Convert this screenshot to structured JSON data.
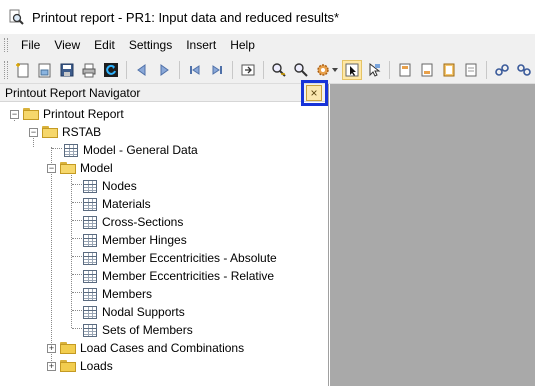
{
  "window": {
    "title": "Printout report - PR1: Input data and reduced results*",
    "icon": "report-magnifier-icon"
  },
  "menubar": {
    "items": [
      "File",
      "View",
      "Edit",
      "Settings",
      "Insert",
      "Help"
    ]
  },
  "toolbar": {
    "buttons": [
      "new-report-icon",
      "open-icon",
      "save-icon",
      "print-icon",
      "refresh-icon",
      "previous-icon",
      "next-icon",
      "first-page-icon",
      "last-page-icon",
      "export-icon",
      "zoom-in-icon",
      "zoom-out-icon",
      "settings-icon",
      "navigator-toggle-icon",
      "select-cursor-icon",
      "page-header-icon",
      "page-icon-1",
      "page-icon-2",
      "page-icon-3",
      "link-icon-1",
      "link-icon-2"
    ],
    "active_button": "navigator-toggle-icon"
  },
  "navigator": {
    "header": "Printout Report Navigator",
    "close_symbol": "×",
    "tree": {
      "root": "Printout Report",
      "rstab": "RSTAB",
      "general": "Model - General Data",
      "model": "Model",
      "model_items": [
        "Nodes",
        "Materials",
        "Cross-Sections",
        "Member Hinges",
        "Member Eccentricities - Absolute",
        "Member Eccentricities - Relative",
        "Members",
        "Nodal Supports",
        "Sets of Members"
      ],
      "load_cases": "Load Cases and Combinations",
      "loads": "Loads"
    }
  },
  "colors": {
    "highlight": "#1733d8",
    "workspace": "#a9a9a9",
    "folder": "#f2cd4e"
  }
}
